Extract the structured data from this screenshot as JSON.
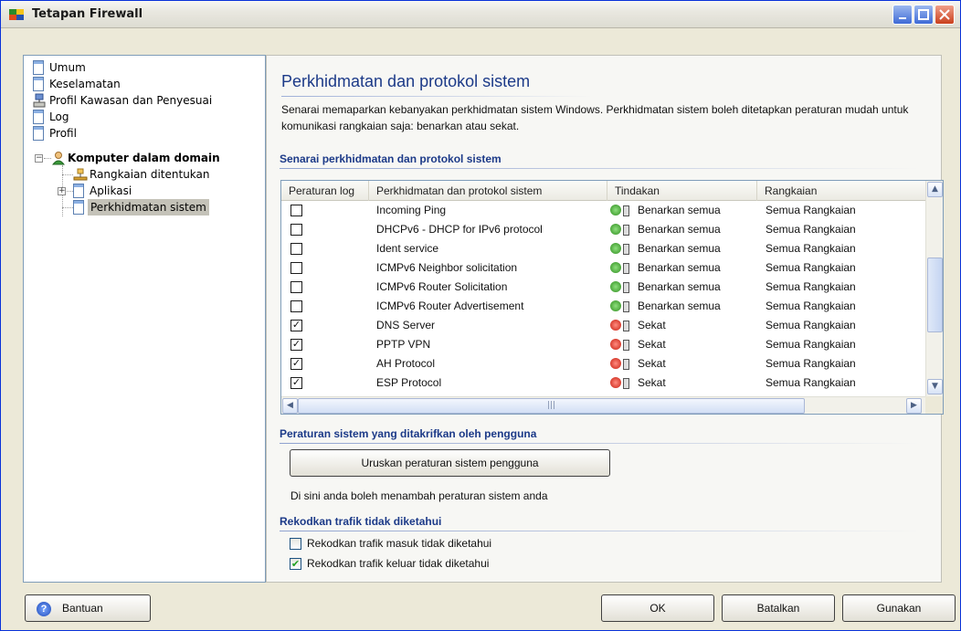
{
  "window": {
    "title": "Tetapan Firewall"
  },
  "tree": {
    "items": [
      {
        "label": "Umum"
      },
      {
        "label": "Keselamatan"
      },
      {
        "label": "Profil Kawasan dan Penyesuai"
      },
      {
        "label": "Log"
      },
      {
        "label": "Profil"
      },
      {
        "label": "Komputer dalam domain"
      },
      {
        "label": "Rangkaian ditentukan"
      },
      {
        "label": "Aplikasi"
      },
      {
        "label": "Perkhidmatan sistem"
      }
    ]
  },
  "main": {
    "title": "Perkhidmatan dan protokol sistem",
    "description": "Senarai memaparkan kebanyakan perkhidmatan sistem Windows. Perkhidmatan sistem boleh ditetapkan peraturan mudah untuk komunikasi rangkaian saja: benarkan atau sekat.",
    "list_heading": "Senarai perkhidmatan dan protokol sistem",
    "columns": [
      "Peraturan log",
      "Perkhidmatan dan protokol sistem",
      "Tindakan",
      "Rangkaian"
    ],
    "rows": [
      {
        "checked": false,
        "service": "Incoming Ping",
        "action": "Benarkan semua",
        "action_type": "allow",
        "network": "Semua Rangkaian"
      },
      {
        "checked": false,
        "service": "DHCPv6 - DHCP for IPv6 protocol",
        "action": "Benarkan semua",
        "action_type": "allow",
        "network": "Semua Rangkaian"
      },
      {
        "checked": false,
        "service": "Ident service",
        "action": "Benarkan semua",
        "action_type": "allow",
        "network": "Semua Rangkaian"
      },
      {
        "checked": false,
        "service": "ICMPv6 Neighbor solicitation",
        "action": "Benarkan semua",
        "action_type": "allow",
        "network": "Semua Rangkaian"
      },
      {
        "checked": false,
        "service": "ICMPv6 Router Solicitation",
        "action": "Benarkan semua",
        "action_type": "allow",
        "network": "Semua Rangkaian"
      },
      {
        "checked": false,
        "service": "ICMPv6 Router Advertisement",
        "action": "Benarkan semua",
        "action_type": "allow",
        "network": "Semua Rangkaian"
      },
      {
        "checked": true,
        "service": "DNS Server",
        "action": "Sekat",
        "action_type": "block",
        "network": "Semua Rangkaian"
      },
      {
        "checked": true,
        "service": "PPTP VPN",
        "action": "Sekat",
        "action_type": "block",
        "network": "Semua Rangkaian"
      },
      {
        "checked": true,
        "service": "AH Protocol",
        "action": "Sekat",
        "action_type": "block",
        "network": "Semua Rangkaian"
      },
      {
        "checked": true,
        "service": "ESP Protocol",
        "action": "Sekat",
        "action_type": "block",
        "network": "Semua Rangkaian"
      }
    ],
    "user_rules_heading": "Peraturan sistem yang ditakrifkan oleh pengguna",
    "user_rules_button": "Uruskan peraturan sistem pengguna",
    "user_rules_note": "Di sini anda boleh menambah peraturan sistem anda",
    "unknown_traffic_heading": "Rekodkan trafik tidak diketahui",
    "log_incoming_label": "Rekodkan trafik masuk tidak diketahui",
    "log_incoming_checked": false,
    "log_outgoing_label": "Rekodkan trafik keluar tidak diketahui",
    "log_outgoing_checked": true
  },
  "footer": {
    "help": "Bantuan",
    "ok": "OK",
    "cancel": "Batalkan",
    "apply": "Gunakan"
  },
  "colors": {
    "title_blue": "#1c3a88",
    "allow": "#2e8d1e",
    "block": "#c81c0e"
  }
}
